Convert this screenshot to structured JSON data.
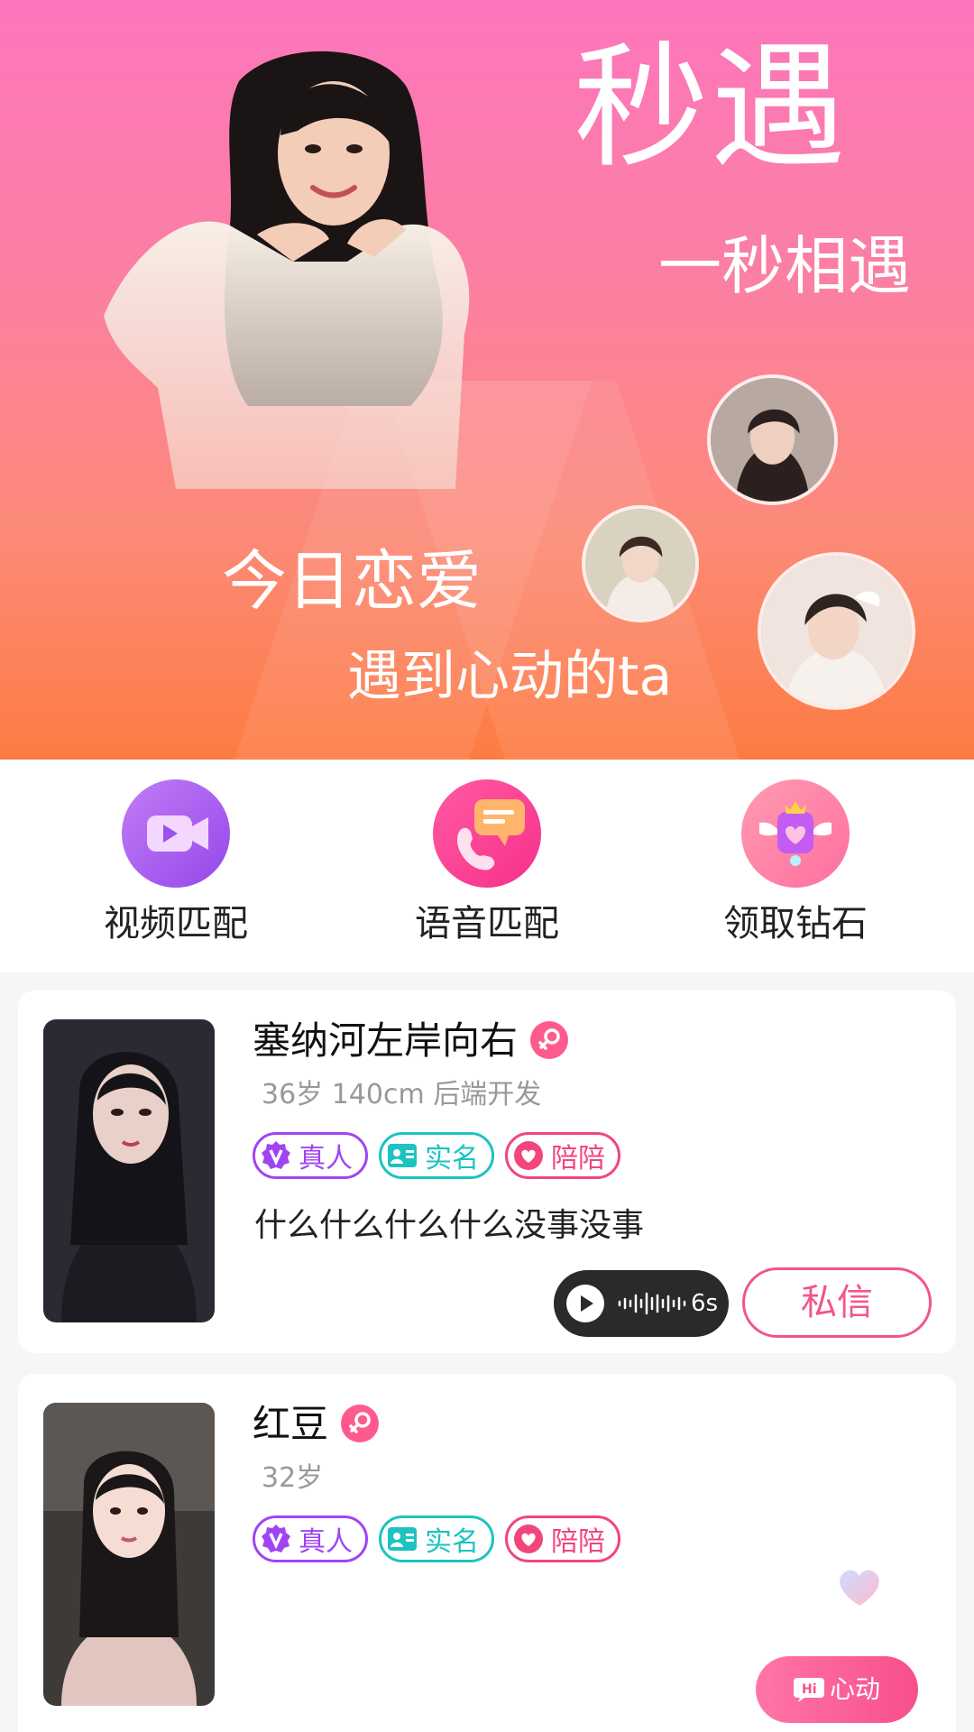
{
  "hero": {
    "title": "秒遇",
    "subtitle_1": "一秒相遇",
    "subtitle_2": "今日恋爱",
    "subtitle_3": "遇到心动的ta",
    "gradient_top": "#fd76bc",
    "gradient_bottom": "#fd7c43"
  },
  "functions": [
    {
      "label": "视频匹配",
      "icon": "video-camera-icon"
    },
    {
      "label": "语音匹配",
      "icon": "phone-chat-icon"
    },
    {
      "label": "领取钻石",
      "icon": "winged-diamond-icon"
    }
  ],
  "users": [
    {
      "name": "塞纳河左岸向右",
      "gender_icon": "female-icon",
      "meta": "36岁  140cm  后端开发",
      "tags": [
        "真人",
        "实名",
        "陪陪"
      ],
      "signature": "什么什么什么什么没事没事",
      "voice_duration": "6s",
      "action_label": "私信"
    },
    {
      "name": "红豆",
      "gender_icon": "female-icon",
      "meta": "32岁",
      "tags": [
        "真人",
        "实名",
        "陪陪"
      ],
      "action_label": "心动"
    }
  ],
  "colors": {
    "accent_pink": "#f25586",
    "tag_real": "#a044f3",
    "tag_name": "#1cc3c1",
    "tag_accom": "#f2457c"
  }
}
